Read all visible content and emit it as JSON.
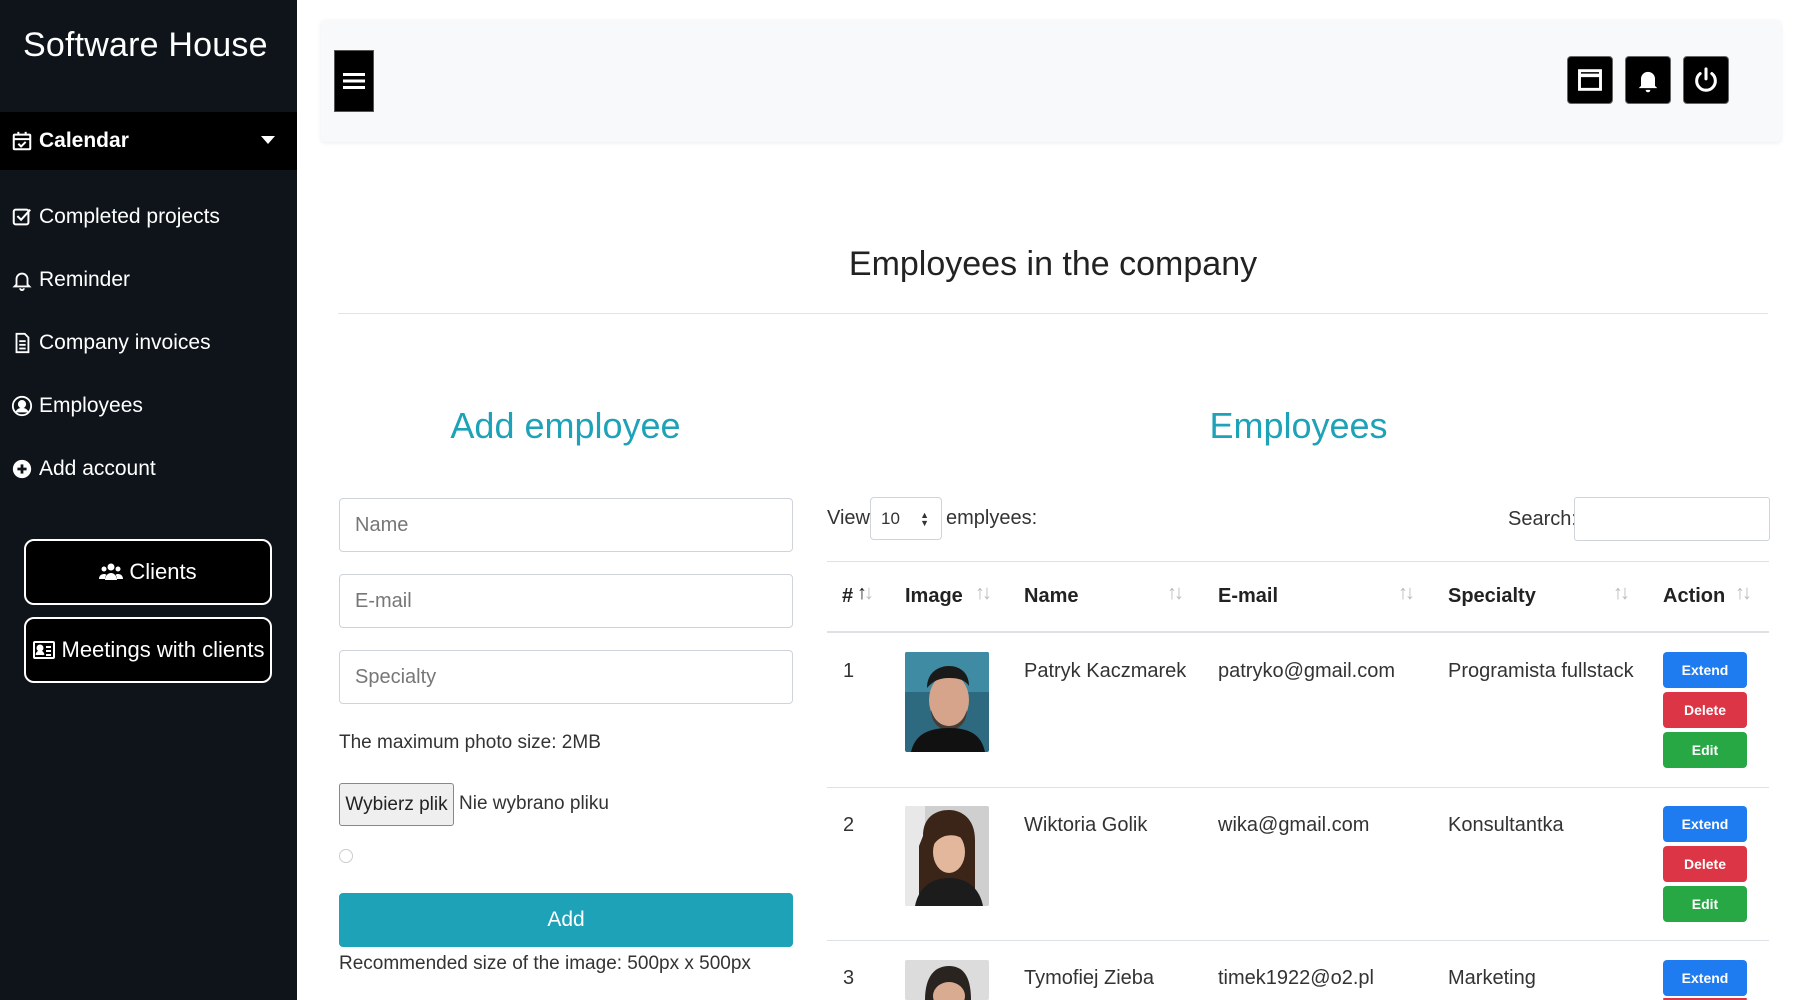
{
  "app": {
    "brand": "Software House"
  },
  "sidebar": {
    "calendar": {
      "label": "Calendar"
    },
    "items": [
      {
        "label": "Completed projects",
        "icon": "check-square-icon"
      },
      {
        "label": "Reminder",
        "icon": "bell-icon"
      },
      {
        "label": "Company invoices",
        "icon": "document-icon"
      },
      {
        "label": "Employees",
        "icon": "user-circle-icon"
      },
      {
        "label": "Add account",
        "icon": "plus-circle-icon"
      }
    ],
    "buttons": {
      "clients": "Clients",
      "meetings": "Meetings with clients"
    }
  },
  "topbar": {
    "icons": [
      "menu-icon",
      "window-icon",
      "bell-icon",
      "power-icon"
    ]
  },
  "page": {
    "title": "Employees in the company"
  },
  "form": {
    "heading": "Add employee",
    "name_placeholder": "Name",
    "email_placeholder": "E-mail",
    "specialty_placeholder": "Specialty",
    "photo_size_note": "The maximum photo size: 2MB",
    "file_button": "Wybierz plik",
    "file_status": "Nie wybrano pliku",
    "submit": "Add",
    "recommended_note": "Recommended size of the image: 500px x 500px"
  },
  "employees": {
    "heading": "Employees",
    "view_label": "View",
    "view_value": "10",
    "view_after": "emplyees:",
    "search_label": "Search:",
    "columns": [
      "#",
      "Image",
      "Name",
      "E-mail",
      "Specialty",
      "Action"
    ],
    "actions": {
      "extend": "Extend",
      "delete": "Delete",
      "edit": "Edit"
    },
    "rows": [
      {
        "num": "1",
        "name": "Patryk Kaczmarek",
        "email": "patryko@gmail.com",
        "specialty": "Programista fullstack"
      },
      {
        "num": "2",
        "name": "Wiktoria Golik",
        "email": "wika@gmail.com",
        "specialty": "Konsultantka"
      },
      {
        "num": "3",
        "name": "Tymofiej Zieba",
        "email": "timek1922@o2.pl",
        "specialty": "Marketing"
      }
    ]
  },
  "colors": {
    "accent": "#1ea2b8",
    "sidebar": "#0e1419",
    "extend": "#1f7cf0",
    "delete": "#dc3545",
    "edit": "#28a745"
  }
}
